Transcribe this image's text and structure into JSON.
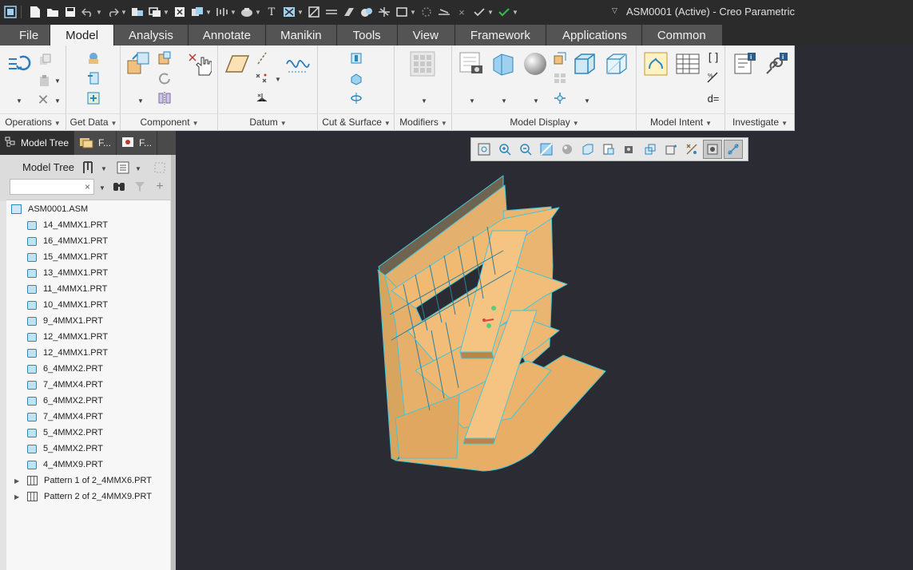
{
  "window": {
    "title": "ASM0001 (Active) - Creo Parametric"
  },
  "quick_access": [
    "new-icon",
    "open-icon",
    "save-icon",
    "undo-icon",
    "redo-icon",
    "regenerate-icon",
    "windows-icon",
    "close-window-icon",
    "copy-icon",
    "steering-icon",
    "appearance-icon",
    "text-icon",
    "layer-icon",
    "repaint-icon",
    "line-icon",
    "sketch-icon",
    "render-icon",
    "wave-icon",
    "rectangle-icon",
    "circle-icon",
    "measure-icon",
    "cancel-icon",
    "check-icon",
    "accept-icon"
  ],
  "menu": {
    "tabs": [
      "File",
      "Model",
      "Analysis",
      "Annotate",
      "Manikin",
      "Tools",
      "View",
      "Framework",
      "Applications",
      "Common"
    ],
    "active": "Model"
  },
  "ribbon": {
    "groups": [
      {
        "label": "Operations"
      },
      {
        "label": "Get Data"
      },
      {
        "label": "Component"
      },
      {
        "label": "Datum"
      },
      {
        "label": "Cut & Surface"
      },
      {
        "label": "Modifiers"
      },
      {
        "label": "Model Display"
      },
      {
        "label": "Model Intent"
      },
      {
        "label": "Investigate"
      }
    ],
    "investigate_text": "d="
  },
  "panel": {
    "tabs": [
      {
        "label": "Model Tree",
        "icon": "model-tree-icon"
      },
      {
        "label": "F...",
        "icon": "folder-browser-icon"
      },
      {
        "label": "F...",
        "icon": "favorites-icon"
      }
    ],
    "tree_title": "Model Tree",
    "search_value": "",
    "search_clear": "×"
  },
  "tree": {
    "root": "ASM0001.ASM",
    "parts": [
      "14_4MMX1.PRT",
      "16_4MMX1.PRT",
      "15_4MMX1.PRT",
      "13_4MMX1.PRT",
      "11_4MMX1.PRT",
      "10_4MMX1.PRT",
      "9_4MMX1.PRT",
      "12_4MMX1.PRT",
      "12_4MMX1.PRT",
      "6_4MMX2.PRT",
      "7_4MMX4.PRT",
      "6_4MMX2.PRT",
      "7_4MMX4.PRT",
      "5_4MMX2.PRT",
      "5_4MMX2.PRT",
      "4_4MMX9.PRT"
    ],
    "patterns": [
      "Pattern 1 of 2_4MMX6.PRT",
      "Pattern 2 of 2_4MMX9.PRT"
    ]
  },
  "view_toolbar": [
    "refit-icon",
    "zoom-in-icon",
    "zoom-out-icon",
    "repaint-icon",
    "display-style-icon",
    "saved-orientations-icon",
    "view-manager-icon",
    "perspective-icon",
    "section-icon",
    "spin-center-icon",
    "annotation-display-icon",
    "datum-display-icon",
    "selection-filter-icon"
  ],
  "colors": {
    "accent": "#1a8fd1",
    "model": "#f2c07d",
    "background": "#2b2c33"
  }
}
